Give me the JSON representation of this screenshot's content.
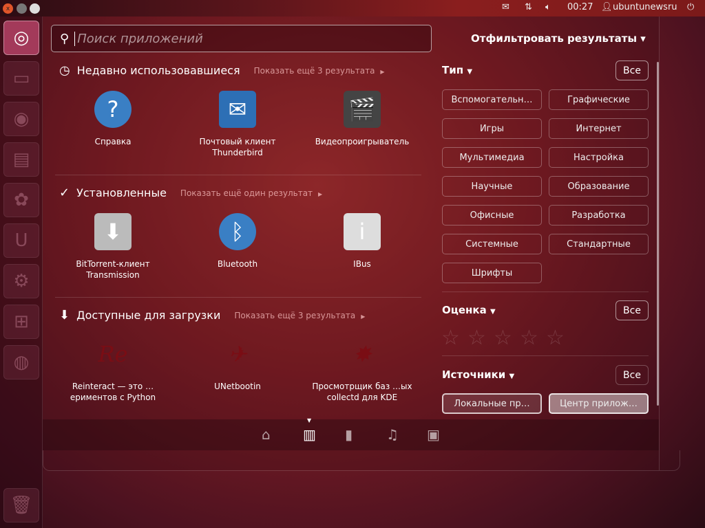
{
  "panel": {
    "time": "00:27",
    "user": "ubuntunewsru",
    "icons": [
      "mail-icon",
      "network-icon",
      "volume-icon",
      "user-icon",
      "power-icon"
    ]
  },
  "window_controls": {
    "close": "x"
  },
  "launcher": {
    "items": [
      "ubuntu-dash",
      "files",
      "firefox",
      "libreoffice-impress",
      "software-center",
      "ubuntu-one",
      "system-settings",
      "workspaces",
      "disc"
    ]
  },
  "search": {
    "placeholder": "Поиск приложений"
  },
  "sections": [
    {
      "title": "Недавно использовавшиеся",
      "more": "Показать ещё 3 результата",
      "icon": "clock-icon",
      "apps": [
        {
          "name": "Справка",
          "icon": "?",
          "color": "#3a7fc4"
        },
        {
          "name": "Почтовый клиент Thunderbird",
          "icon": "✉",
          "color": "#2d6fb5"
        },
        {
          "name": "Видеопроигрыватель",
          "icon": "🎬",
          "color": "#444"
        }
      ]
    },
    {
      "title": "Установленные",
      "more": "Показать ещё один результат",
      "icon": "check-icon",
      "apps": [
        {
          "name": "BitTorrent-клиент Transmission",
          "icon": "⬇",
          "color": "#bbb"
        },
        {
          "name": "Bluetooth",
          "icon": "ᛒ",
          "color": "#3a7fc4"
        },
        {
          "name": "IBus",
          "icon": "i",
          "color": "#ddd"
        }
      ]
    },
    {
      "title": "Доступные для загрузки",
      "more": "Показать ещё 3 результата",
      "icon": "download-icon",
      "apps": [
        {
          "name": "Reinteract — это …ериментов с Python",
          "icon": "Re",
          "color": "transparent"
        },
        {
          "name": "UNetbootin",
          "icon": "✈",
          "color": "transparent"
        },
        {
          "name": "Просмотрщик баз …ых collectd для KDE",
          "icon": "✸",
          "color": "transparent"
        }
      ]
    }
  ],
  "filters": {
    "title": "Отфильтровать результаты",
    "type": {
      "label": "Тип",
      "all": "Все",
      "options": [
        "Вспомогательн…",
        "Графические",
        "Игры",
        "Интернет",
        "Мультимедиа",
        "Настройка",
        "Научные",
        "Образование",
        "Офисные",
        "Разработка",
        "Системные",
        "Стандартные",
        "Шрифты"
      ]
    },
    "rating": {
      "label": "Оценка",
      "all": "Все",
      "stars": 0
    },
    "sources": {
      "label": "Источники",
      "all": "Все",
      "options": [
        "Локальные пр…",
        "Центр прилож…"
      ]
    }
  },
  "lenses": [
    "home-icon",
    "applications-icon",
    "files-icon",
    "music-icon",
    "video-icon"
  ]
}
